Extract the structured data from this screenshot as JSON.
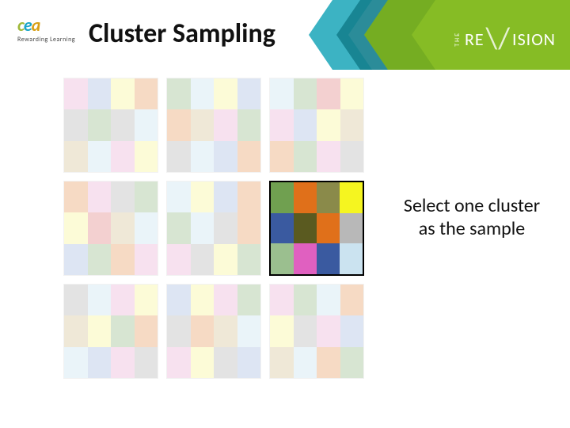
{
  "logo": {
    "c1": "c",
    "c2": "e",
    "c3": "a",
    "sub": "Rewarding Learning"
  },
  "title": "Cluster Sampling",
  "brand": {
    "the": "THE",
    "pre": "RE",
    "sep": "\\/",
    "post": "ISION"
  },
  "caption_line1": "Select one cluster",
  "caption_line2": "as the sample",
  "palette": {
    "pink": "#eab4d6",
    "yellow": "#f7f49b",
    "blue": "#a9bfe0",
    "orange": "#e8a26c",
    "green": "#9bbf8f",
    "grey": "#b8b8b8",
    "ltblue": "#cbe3f0",
    "tan": "#d6c69a",
    "red": "#e08a8a",
    "olive": "#8a8a4a",
    "magenta": "#e060c0",
    "navy": "#3a5aa0",
    "brightyellow": "#f5f520",
    "darkorange": "#e0701a",
    "darkolive": "#5a5a20",
    "mediumgreen": "#70a050"
  },
  "clusters": [
    {
      "faded": true,
      "selected": false,
      "cells": [
        "pink",
        "blue",
        "yellow",
        "orange",
        "grey",
        "green",
        "grey",
        "ltblue",
        "tan",
        "ltblue",
        "pink",
        "yellow"
      ]
    },
    {
      "faded": true,
      "selected": false,
      "cells": [
        "green",
        "ltblue",
        "yellow",
        "blue",
        "orange",
        "tan",
        "pink",
        "green",
        "grey",
        "ltblue",
        "blue",
        "orange"
      ]
    },
    {
      "faded": true,
      "selected": false,
      "cells": [
        "ltblue",
        "green",
        "red",
        "yellow",
        "pink",
        "blue",
        "yellow",
        "tan",
        "orange",
        "green",
        "pink",
        "grey"
      ]
    },
    {
      "faded": true,
      "selected": false,
      "cells": [
        "orange",
        "pink",
        "grey",
        "green",
        "yellow",
        "red",
        "tan",
        "ltblue",
        "blue",
        "green",
        "orange",
        "pink"
      ]
    },
    {
      "faded": true,
      "selected": false,
      "cells": [
        "ltblue",
        "yellow",
        "blue",
        "orange",
        "green",
        "ltblue",
        "grey",
        "orange",
        "pink",
        "grey",
        "yellow",
        "green"
      ]
    },
    {
      "faded": false,
      "selected": true,
      "cells": [
        "mediumgreen",
        "darkorange",
        "olive",
        "brightyellow",
        "navy",
        "darkolive",
        "darkorange",
        "grey",
        "green",
        "magenta",
        "navy",
        "ltblue"
      ]
    },
    {
      "faded": true,
      "selected": false,
      "cells": [
        "grey",
        "ltblue",
        "pink",
        "yellow",
        "tan",
        "yellow",
        "green",
        "orange",
        "ltblue",
        "blue",
        "pink",
        "grey"
      ]
    },
    {
      "faded": true,
      "selected": false,
      "cells": [
        "blue",
        "yellow",
        "pink",
        "green",
        "grey",
        "orange",
        "tan",
        "ltblue",
        "pink",
        "yellow",
        "grey",
        "blue"
      ]
    },
    {
      "faded": true,
      "selected": false,
      "cells": [
        "pink",
        "green",
        "ltblue",
        "orange",
        "yellow",
        "grey",
        "pink",
        "blue",
        "tan",
        "ltblue",
        "orange",
        "green"
      ]
    }
  ]
}
